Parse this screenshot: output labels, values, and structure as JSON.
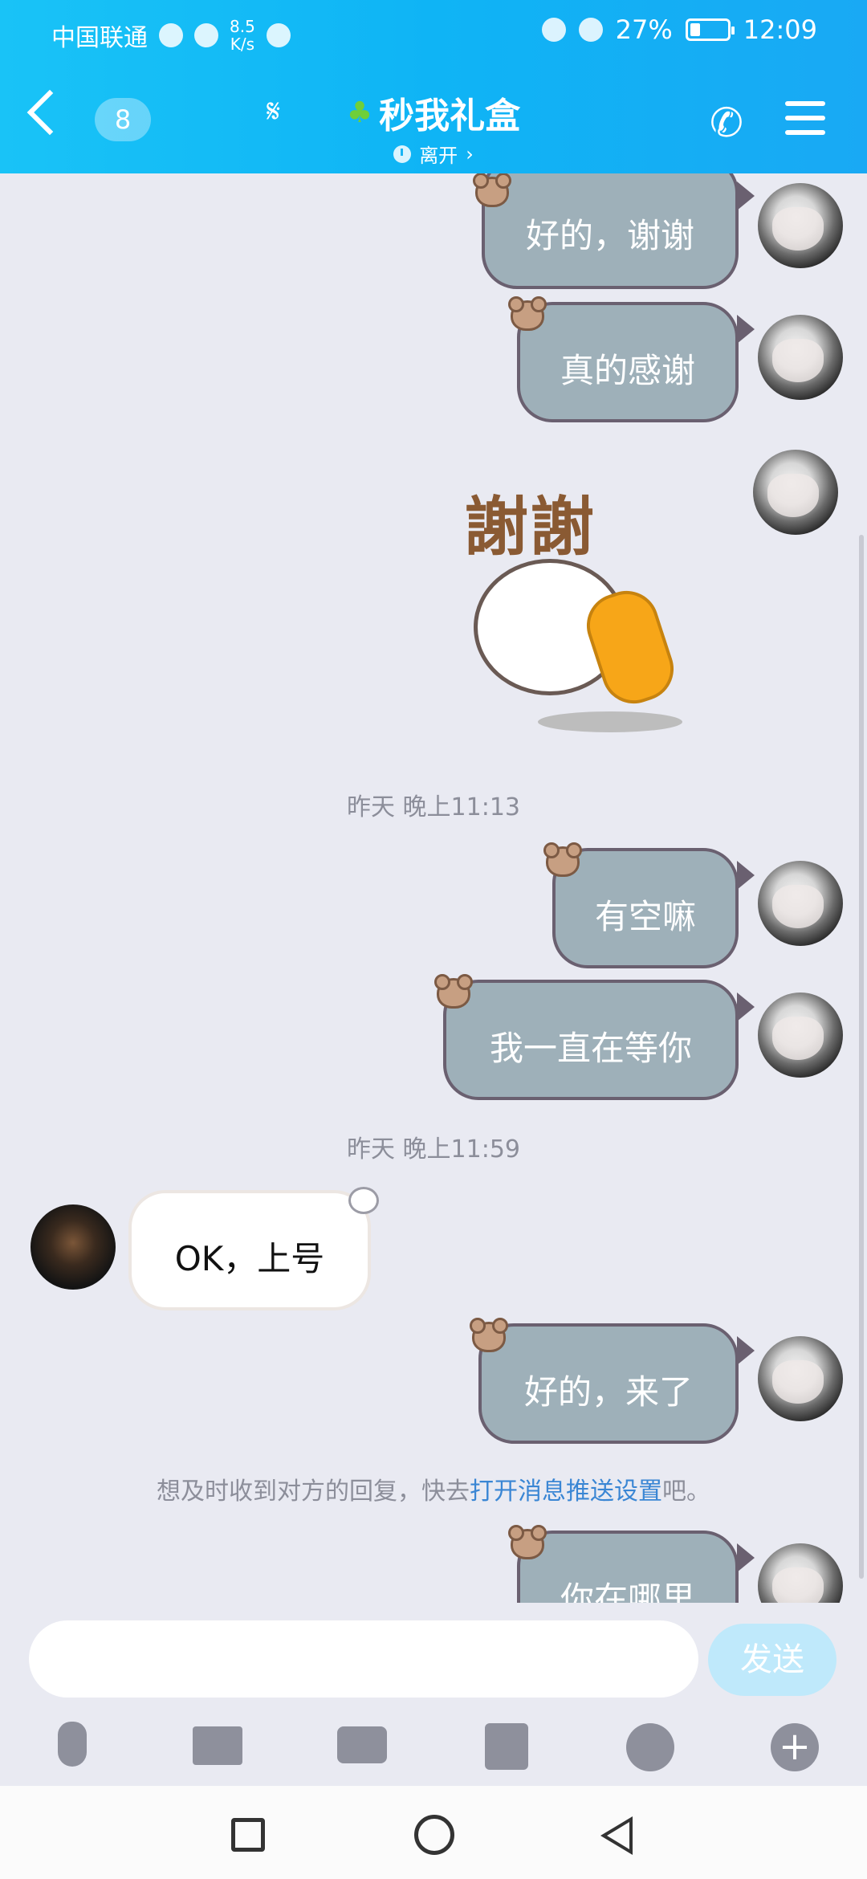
{
  "status_bar": {
    "carrier": "中国联通",
    "net_speed_value": "8.5",
    "net_speed_unit": "K/s",
    "battery": "27%",
    "time": "12:09"
  },
  "header": {
    "unread_count": "8",
    "contact_name": "秒我礼盒",
    "presence": "离开"
  },
  "messages": {
    "m1": "好的，谢谢",
    "m2": "真的感谢",
    "sticker_text": "謝謝",
    "ts1": "昨天 晚上11:13",
    "m3": "有空嘛",
    "m4": "我一直在等你",
    "ts2": "昨天 晚上11:59",
    "m5": "OK，上号",
    "m6": "好的，来了",
    "hint_prefix": "想及时收到对方的回复，快去",
    "hint_link": "打开消息推送设置",
    "hint_suffix": "吧。",
    "m7": "你在哪里"
  },
  "input": {
    "send_label": "发送"
  },
  "colors": {
    "header": "#19b5f5",
    "my_bubble": "#9eb0b9",
    "bubble_border": "#6a6070",
    "background": "#e9eaf2",
    "link": "#3a86d4"
  }
}
